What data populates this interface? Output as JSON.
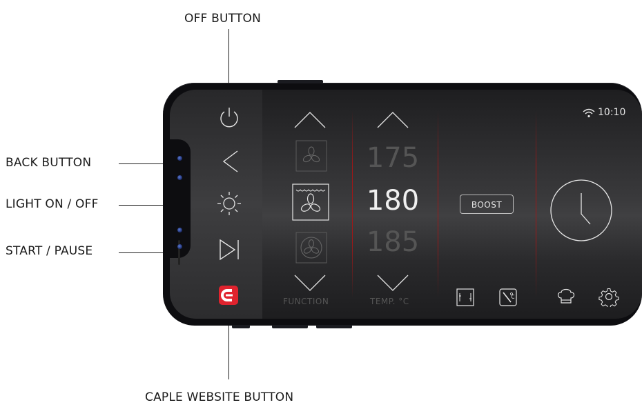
{
  "callouts": {
    "off_button": "OFF BUTTON",
    "back_button": "BACK BUTTON",
    "light_toggle": "LIGHT ON / OFF",
    "start_pause": "START / PAUSE",
    "website_button": "CAPLE WEBSITE BUTTON"
  },
  "status_bar": {
    "time": "10:10",
    "wifi_icon": "wifi-icon"
  },
  "function_column": {
    "caption": "FUNCTION",
    "selected_mode_icon": "fan-with-top-heat-icon",
    "prev_mode_icon": "fan-icon",
    "next_mode_icon": "fan-circle-icon"
  },
  "temperature_column": {
    "caption": "TEMP. °C",
    "prev": "175",
    "current": "180",
    "next": "185"
  },
  "boost": {
    "label": "BOOST"
  },
  "colors": {
    "accent_red": "#e0232e",
    "divider_red": "#aa1414",
    "text_light": "#e6e6e6",
    "text_dim": "#555555"
  }
}
